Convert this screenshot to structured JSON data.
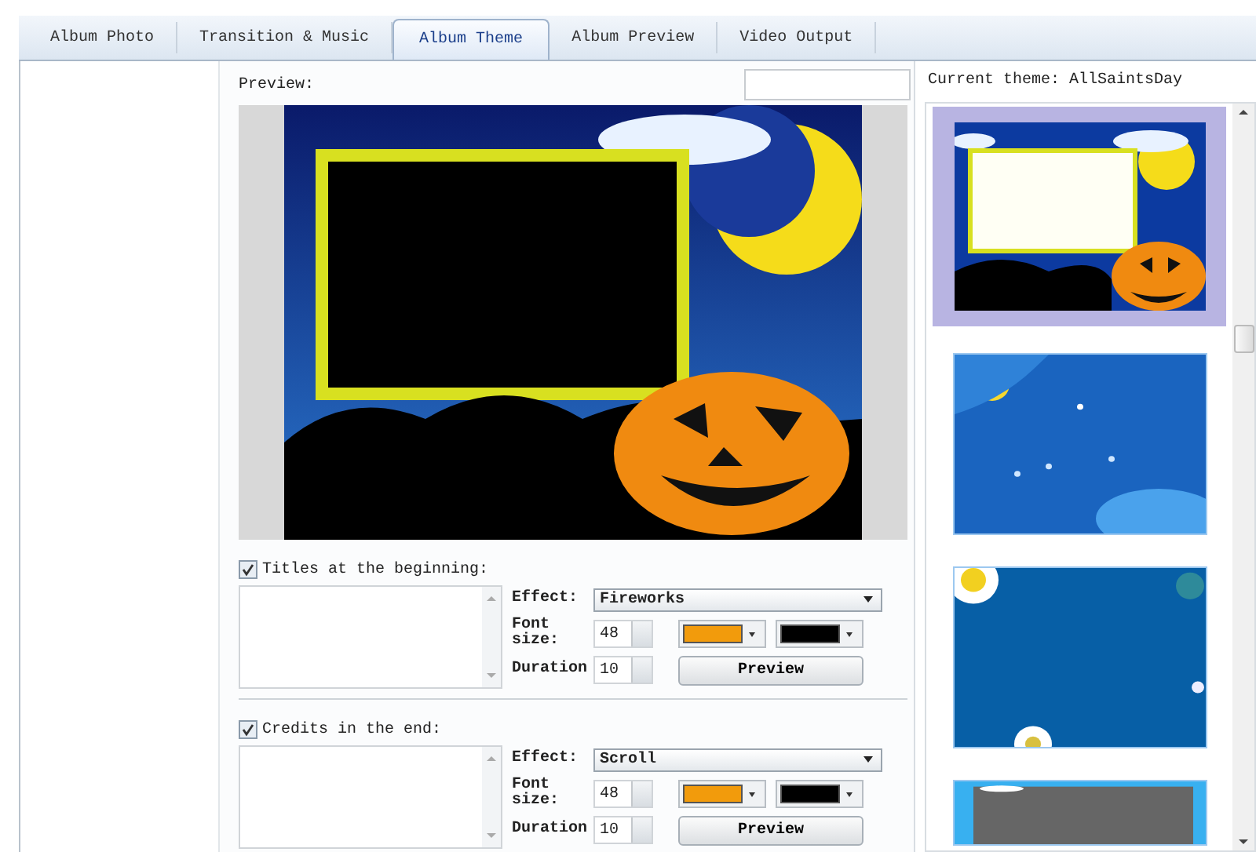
{
  "tabs": [
    {
      "label": "Album Photo",
      "selected": false
    },
    {
      "label": "Transition & Music",
      "selected": false
    },
    {
      "label": "Album Theme",
      "selected": true
    },
    {
      "label": "Album Preview",
      "selected": false
    },
    {
      "label": "Video Output",
      "selected": false
    }
  ],
  "preview": {
    "label": "Preview:"
  },
  "sections": [
    {
      "label": "Titles at the beginning:",
      "checked": true,
      "effect_label": "Effect:",
      "effect": "Fireworks",
      "font_size_label": "Font size:",
      "font_size": "48",
      "duration_label": "Duration",
      "duration": "10",
      "swatches": [
        {
          "color": "#f29b0c"
        },
        {
          "color": "#000000"
        }
      ],
      "button": "Preview"
    },
    {
      "label": "Credits in the end:",
      "checked": true,
      "effect_label": "Effect:",
      "effect": "Scroll",
      "font_size_label": "Font size:",
      "font_size": "48",
      "duration_label": "Duration",
      "duration": "10",
      "swatches": [
        {
          "color": "#f29b0c"
        },
        {
          "color": "#000000"
        }
      ],
      "button": "Preview"
    }
  ],
  "current_theme": "Current theme: AllSaintsDay",
  "themes": [
    {
      "selected": true
    },
    {
      "selected": false
    },
    {
      "selected": false
    },
    {
      "selected": false
    }
  ]
}
